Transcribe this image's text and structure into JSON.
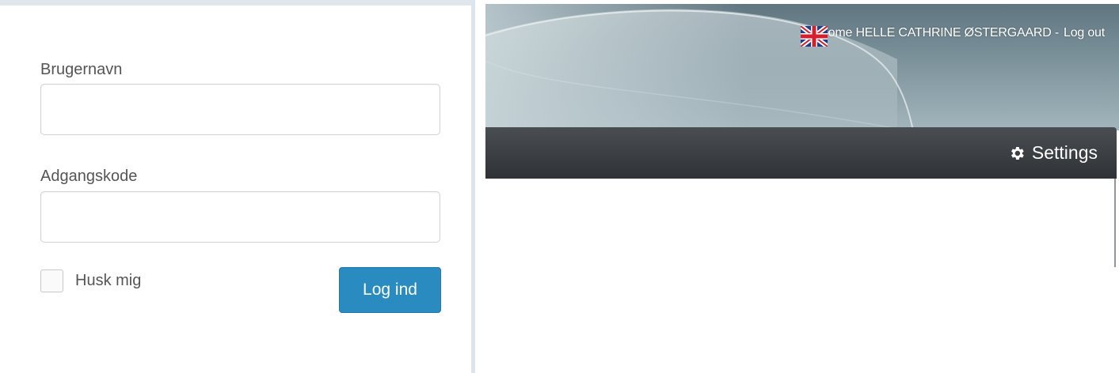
{
  "login": {
    "username_label": "Brugernavn",
    "username_value": "",
    "password_label": "Adgangskode",
    "password_value": "",
    "remember_label": "Husk mig",
    "remember_checked": false,
    "submit_label": "Log ind"
  },
  "header": {
    "welcome_text": "Welcome HELLE CATHRINE ØSTERGAARD -",
    "logout_label": "Log out",
    "flags": [
      "danish-flag-icon",
      "uk-flag-icon"
    ]
  },
  "navbar": {
    "settings_label": "Settings",
    "settings_icon": "gear-icon"
  },
  "colors": {
    "button_primary": "#2a8bc0",
    "navbar_dark": "#2f3235",
    "banner_slate": "#7d939c"
  }
}
